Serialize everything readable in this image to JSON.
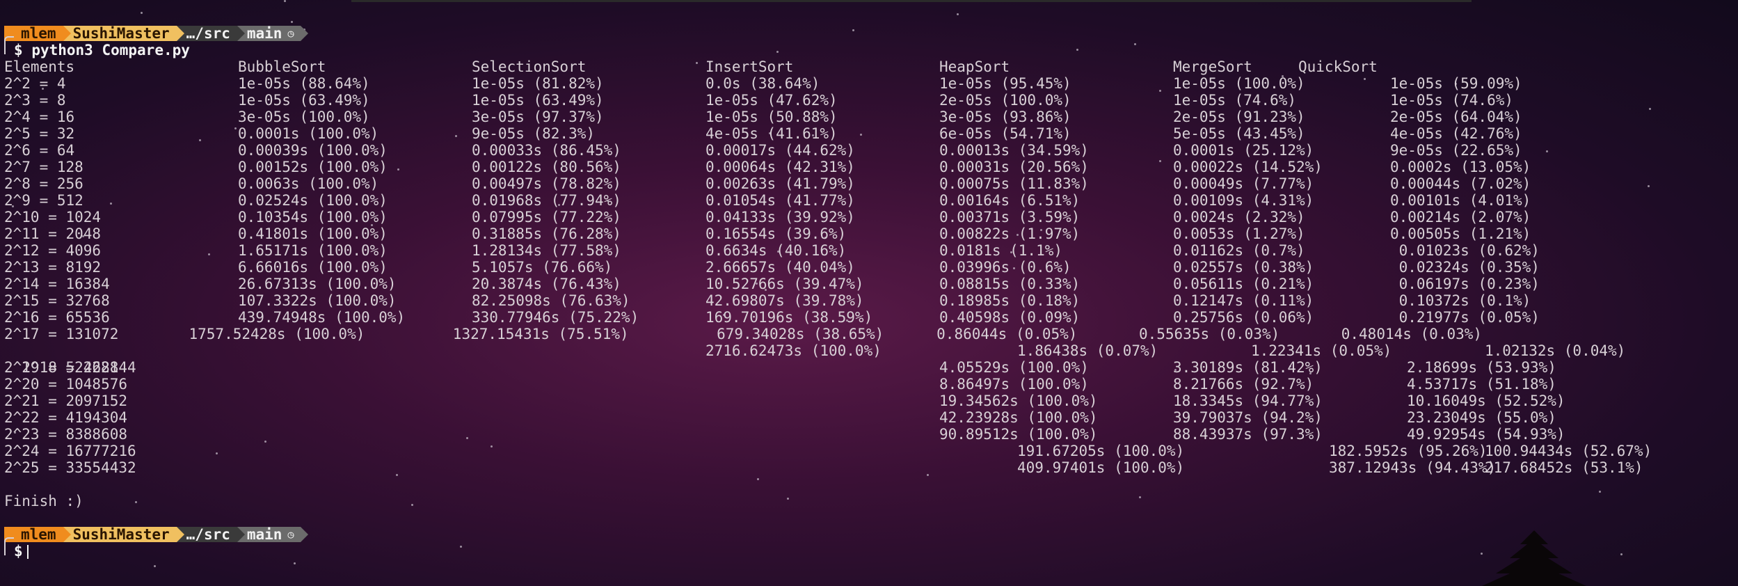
{
  "terminal": {
    "prompt": {
      "user": "mlem",
      "host": "SushiMaster",
      "dir": "…/src",
      "branch": "main",
      "branch_icon": "clock-icon",
      "symbol": "$"
    },
    "command": "python3 Compare.py",
    "header": {
      "elements": "Elements",
      "bubble": "BubbleSort",
      "selection": "SelectionSort",
      "insert": "InsertSort",
      "heap": "HeapSort",
      "merge": "MergeSort",
      "quick": "QuickSort"
    },
    "rows": [
      {
        "n": "2^2 = 4",
        "c": [
          "1e-05s (88.64%)",
          "1e-05s (81.82%)",
          "0.0s (38.64%)",
          "1e-05s (95.45%)",
          "1e-05s (100.0%)",
          "1e-05s (59.09%)"
        ]
      },
      {
        "n": "2^3 = 8",
        "c": [
          "1e-05s (63.49%)",
          "1e-05s (63.49%)",
          "1e-05s (47.62%)",
          "2e-05s (100.0%)",
          "1e-05s (74.6%)",
          "1e-05s (74.6%)"
        ]
      },
      {
        "n": "2^4 = 16",
        "c": [
          "3e-05s (100.0%)",
          "3e-05s (97.37%)",
          "1e-05s (50.88%)",
          "3e-05s (93.86%)",
          "2e-05s (91.23%)",
          "2e-05s (64.04%)"
        ]
      },
      {
        "n": "2^5 = 32",
        "c": [
          "0.0001s (100.0%)",
          "9e-05s (82.3%)",
          "4e-05s (41.61%)",
          "6e-05s (54.71%)",
          "5e-05s (43.45%)",
          "4e-05s (42.76%)"
        ]
      },
      {
        "n": "2^6 = 64",
        "c": [
          "0.00039s (100.0%)",
          "0.00033s (86.45%)",
          "0.00017s (44.62%)",
          "0.00013s (34.59%)",
          "0.0001s (25.12%)",
          "9e-05s (22.65%)"
        ]
      },
      {
        "n": "2^7 = 128",
        "c": [
          "0.00152s (100.0%)",
          "0.00122s (80.56%)",
          "0.00064s (42.31%)",
          "0.00031s (20.56%)",
          "0.00022s (14.52%)",
          "0.0002s (13.05%)"
        ]
      },
      {
        "n": "2^8 = 256",
        "c": [
          "0.0063s (100.0%)",
          "0.00497s (78.82%)",
          "0.00263s (41.79%)",
          "0.00075s (11.83%)",
          "0.00049s (7.77%)",
          "0.00044s (7.02%)"
        ]
      },
      {
        "n": "2^9 = 512",
        "c": [
          "0.02524s (100.0%)",
          "0.01968s (77.94%)",
          "0.01054s (41.77%)",
          "0.00164s (6.51%)",
          "0.00109s (4.31%)",
          "0.00101s (4.01%)"
        ]
      },
      {
        "n": "2^10 = 1024",
        "c": [
          "0.10354s (100.0%)",
          "0.07995s (77.22%)",
          "0.04133s (39.92%)",
          "0.00371s (3.59%)",
          "0.0024s (2.32%)",
          "0.00214s (2.07%)"
        ]
      },
      {
        "n": "2^11 = 2048",
        "c": [
          "0.41801s (100.0%)",
          "0.31885s (76.28%)",
          "0.16554s (39.6%)",
          "0.00822s (1.97%)",
          "0.0053s (1.27%)",
          "0.00505s (1.21%)"
        ]
      },
      {
        "n": "2^12 = 4096",
        "c": [
          "1.65171s (100.0%)",
          "1.28134s (77.58%)",
          "0.6634s (40.16%)",
          "0.0181s (1.1%)",
          "0.01162s (0.7%)",
          " 0.01023s (0.62%)"
        ]
      },
      {
        "n": "2^13 = 8192",
        "c": [
          "6.66016s (100.0%)",
          "5.1057s (76.66%)",
          "2.66657s (40.04%)",
          "0.03996s (0.6%)",
          "0.02557s (0.38%)",
          " 0.02324s (0.35%)"
        ]
      },
      {
        "n": "2^14 = 16384",
        "c": [
          "26.67313s (100.0%)",
          "20.3874s (76.43%)",
          "10.52766s (39.47%)",
          "0.08815s (0.33%)",
          "0.05611s (0.21%)",
          " 0.06197s (0.23%)"
        ]
      },
      {
        "n": "2^15 = 32768",
        "c": [
          "107.3322s (100.0%)",
          "82.25098s (76.63%)",
          "42.69807s (39.78%)",
          "0.18985s (0.18%)",
          "0.12147s (0.11%)",
          " 0.10372s (0.1%)"
        ]
      },
      {
        "n": "2^16 = 65536",
        "c": [
          "439.74948s (100.0%)",
          "330.77946s (75.22%)",
          "169.70196s (38.59%)",
          "0.40598s (0.09%)",
          "0.25756s (0.06%)",
          " 0.21977s (0.05%)"
        ]
      }
    ],
    "line_17": "2^17 = 131072        1757.52428s (100.0%)          1327.15431s (75.51%)          679.34028s (38.65%)      0.86044s (0.05%)       0.55635s (0.03%)       0.48014s (0.03%)",
    "line_18": "2^18 = 262144                                        2716.62473s (100.0%)          1.86438s (0.07%)       1.22341s (0.05%)       1.02132s (0.04%)",
    "rows_late": [
      {
        "n": "2^19 = 524288",
        "h": "4.05529s (100.0%)",
        "m": "3.30189s (81.42%)",
        "q": "2.18699s (53.93%)"
      },
      {
        "n": "2^20 = 1048576",
        "h": "8.86497s (100.0%)",
        "m": "8.21766s (92.7%)",
        "q": "4.53717s (51.18%)"
      },
      {
        "n": "2^21 = 2097152",
        "h": "19.34562s (100.0%)",
        "m": "18.3345s (94.77%)",
        "q": "10.16049s (52.52%)"
      },
      {
        "n": "2^22 = 4194304",
        "h": "42.23928s (100.0%)",
        "m": "39.79037s (94.2%)",
        "q": "23.23049s (55.0%)"
      },
      {
        "n": "2^23 = 8388608",
        "h": "90.89512s (100.0%)",
        "m": "88.43937s (97.3%)",
        "q": "49.92954s (54.93%)"
      }
    ],
    "rows_last": [
      {
        "n": "2^24 = 16777216",
        "h": "191.67205s (100.0%)",
        "m": "182.5952s (95.26%)",
        "q": "100.94434s (52.67%)"
      },
      {
        "n": "2^25 = 33554432",
        "h": "409.97401s (100.0%)",
        "m": "387.12943s (94.43%)",
        "q": "217.68452s (53.1%)"
      }
    ],
    "finish": "Finish :)"
  }
}
